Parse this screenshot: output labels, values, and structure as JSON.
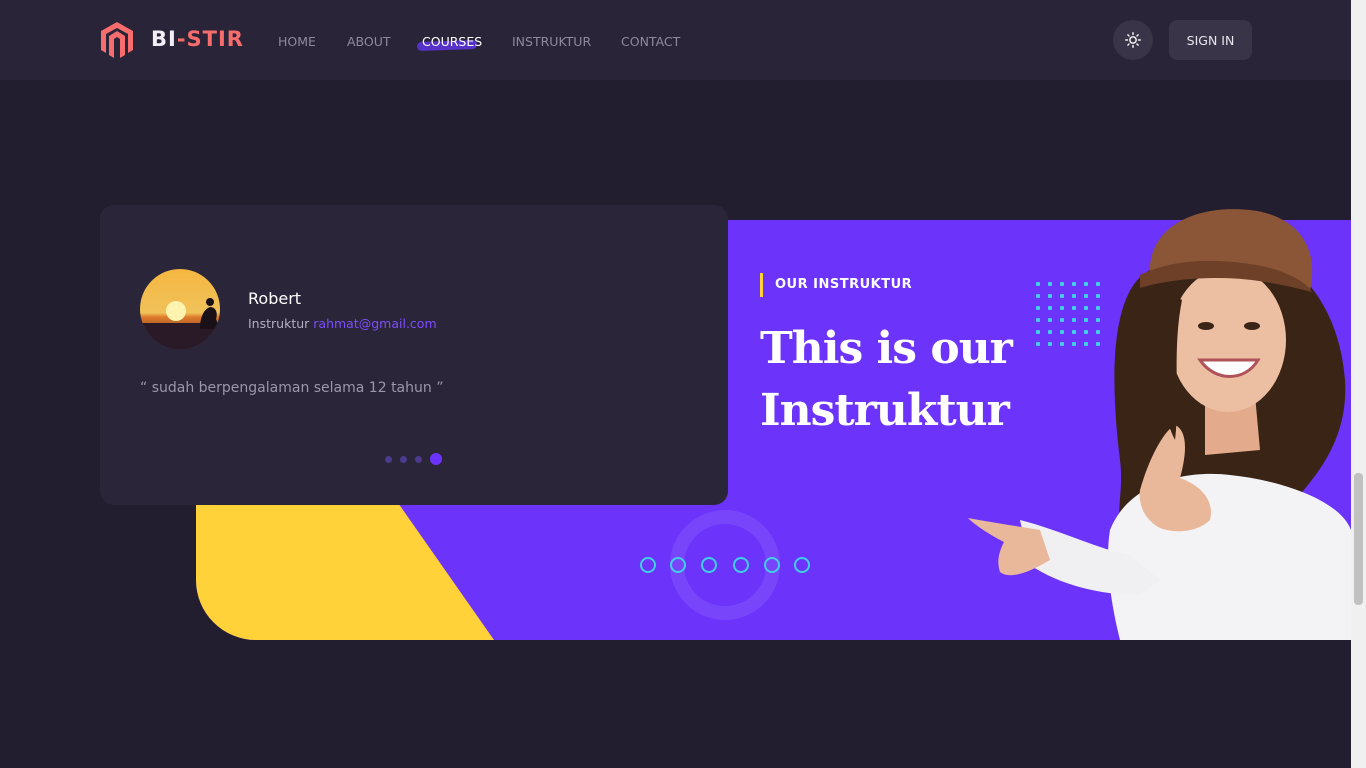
{
  "brand": {
    "part1": "BI",
    "part2": "-STIR"
  },
  "nav": {
    "items": [
      {
        "label": "HOME",
        "active": false
      },
      {
        "label": "ABOUT",
        "active": false
      },
      {
        "label": "COURSES",
        "active": true
      },
      {
        "label": "INSTRUKTUR",
        "active": false
      },
      {
        "label": "CONTACT",
        "active": false
      }
    ]
  },
  "header": {
    "theme_icon": "sun-icon",
    "signin_label": "SIGN IN"
  },
  "card": {
    "name": "Robert",
    "role": "Instruktur",
    "email": "rahmat@gmail.com",
    "quote": "“ sudah berpengalaman selama 12 tahun ”",
    "pager_count": 4,
    "pager_active": 4
  },
  "banner": {
    "eyebrow": "OUR INSTRUKTUR",
    "headline_line1": "This is our",
    "headline_line2": "Instruktur"
  },
  "colors": {
    "background": "#221e2f",
    "header": "#2a2438",
    "accent_purple": "#6c33fb",
    "accent_yellow": "#ffd23a",
    "brand_red": "#f76d6d",
    "cyan": "#3fd0e8"
  }
}
